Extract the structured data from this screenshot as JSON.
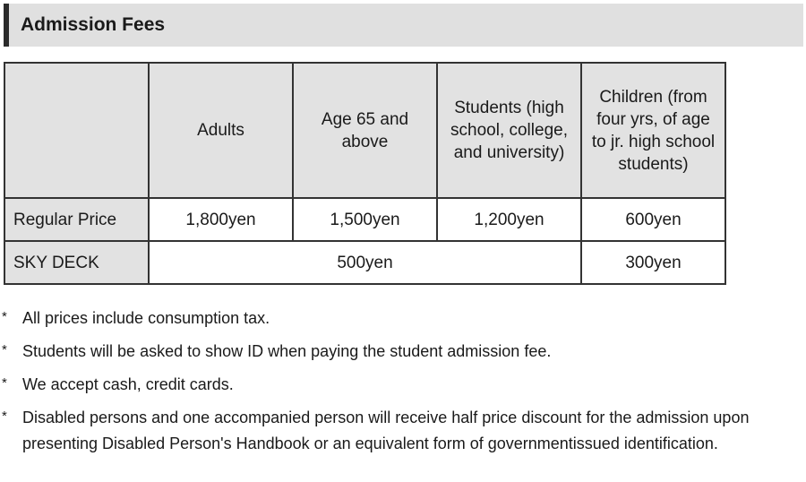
{
  "section": {
    "title": "Admission Fees"
  },
  "table": {
    "headers": {
      "adults": "Adults",
      "seniors": "Age 65 and above",
      "students": "Students (high school, college, and university)",
      "children": "Children (from four yrs, of age to jr. high school students)"
    },
    "rows": {
      "regular": {
        "label": "Regular Price",
        "adults": "1,800yen",
        "seniors": "1,500yen",
        "students": "1,200yen",
        "children": "600yen"
      },
      "skydeck": {
        "label": "SKY DECK",
        "adults_students": "500yen",
        "children": "300yen"
      }
    }
  },
  "notes": {
    "bullet": "*",
    "items": [
      "All prices include consumption tax.",
      "Students will be asked to show ID when paying the student admission fee.",
      "We accept cash, credit cards.",
      "Disabled persons and one accompanied person will receive half price discount for the admission upon presenting Disabled Person's Handbook or an equivalent form of governmentissued identification."
    ]
  }
}
